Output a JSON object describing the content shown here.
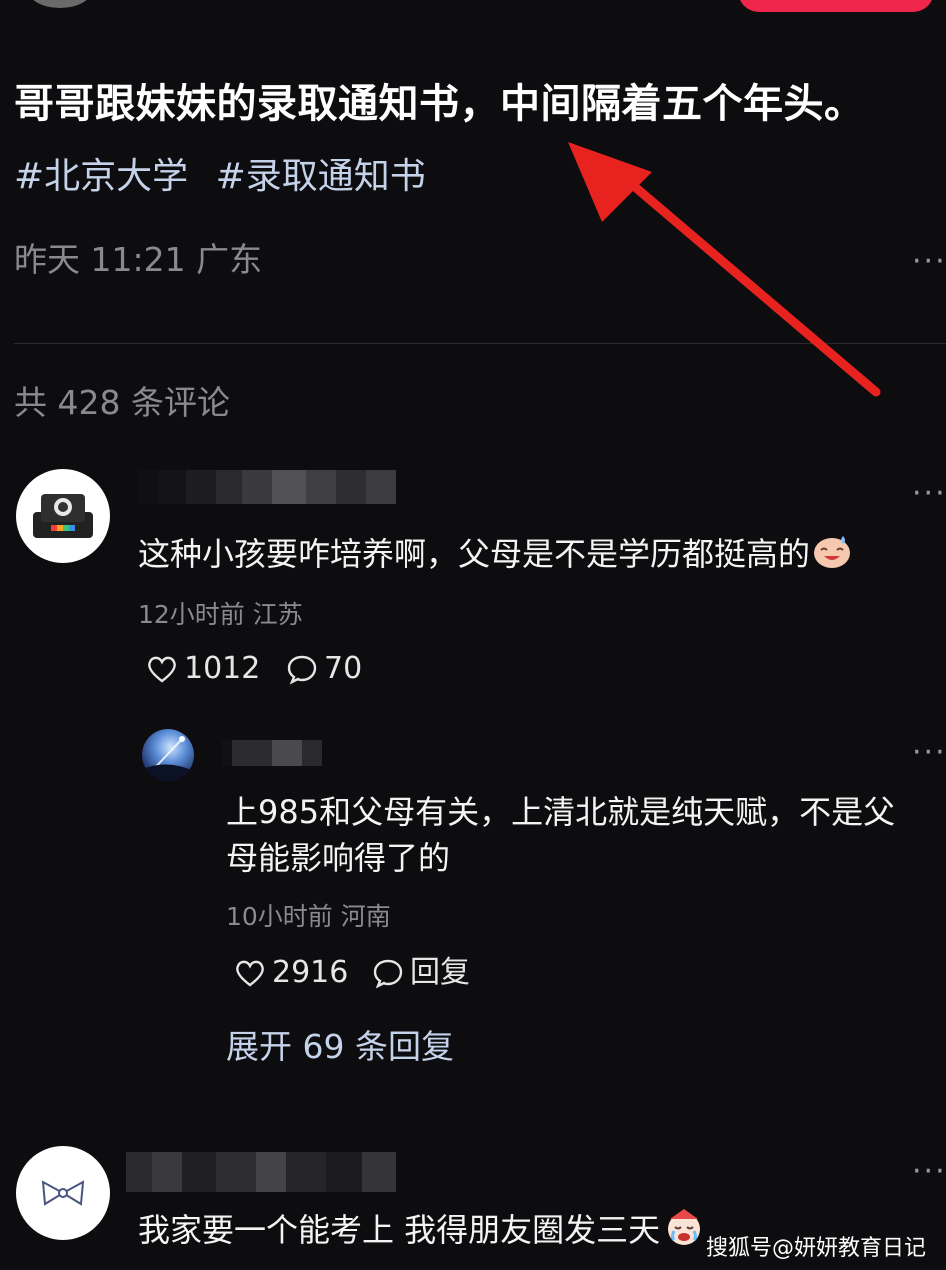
{
  "post": {
    "title": "哥哥跟妹妹的录取通知书，中间隔着五个年头。",
    "hashtags": [
      "#北京大学",
      "#录取通知书"
    ],
    "meta": "昨天 11:21 广东",
    "more": "···"
  },
  "comments_header": {
    "count_text": "共 428 条评论"
  },
  "comments": [
    {
      "avatar_icon": "polaroid-camera-icon",
      "text": "这种小孩要咋培养啊，父母是不是学历都挺高的",
      "emoji_icon": "sweat-smile-emoji-icon",
      "meta": "12小时前 江苏",
      "likes": "1012",
      "replies": "70",
      "more": "···",
      "reply": {
        "avatar_icon": "night-sky-meteor-icon",
        "text_line1": "上985和父母有关，上清北就是纯天赋，不是父",
        "text_line2": "母能影响得了的",
        "meta": "10小时前 河南",
        "likes": "2916",
        "reply_label": "回复",
        "more": "···"
      },
      "expand_text": "展开 69 条回复"
    },
    {
      "avatar_icon": "bow-tie-icon",
      "text": "我家要一个能考上 我得朋友圈发三天",
      "emoji_icon": "crying-clown-emoji-icon",
      "more": "···"
    }
  ],
  "annotation": {
    "arrow_color": "#e8231f",
    "icon": "red-arrow-icon"
  },
  "watermark": "搜狐号@妍妍教育日记",
  "colors": {
    "background": "#0d0c0e",
    "link": "#c5d3ea",
    "muted": "#8a8a8d",
    "accent": "#f0264d"
  }
}
